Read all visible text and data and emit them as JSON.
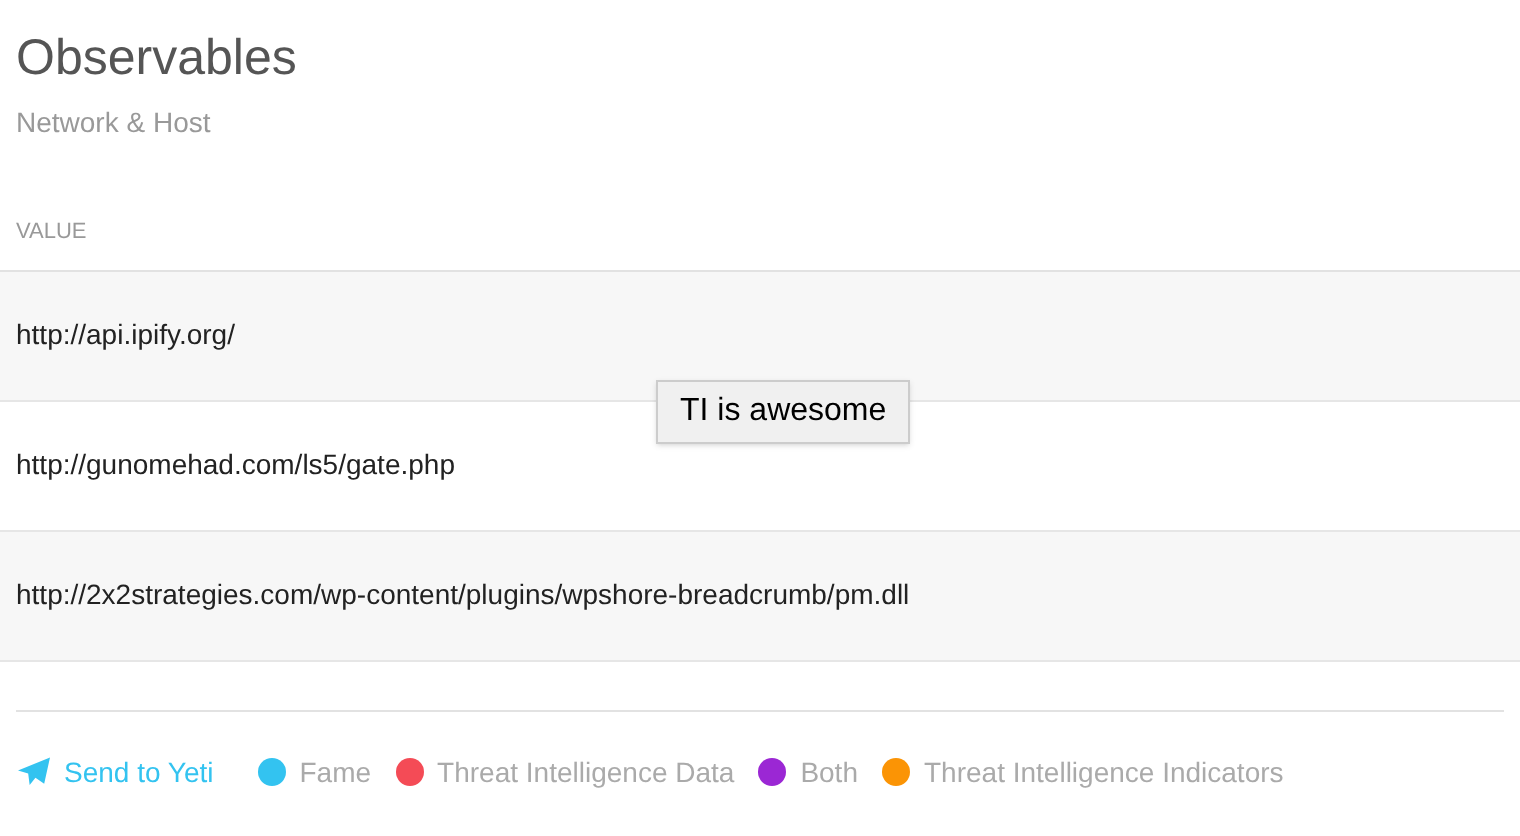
{
  "header": {
    "title": "Observables",
    "subtitle": "Network & Host"
  },
  "table": {
    "columns": [
      "VALUE"
    ],
    "rows": [
      [
        "http://api.ipify.org/"
      ],
      [
        "http://gunomehad.com/ls5/gate.php"
      ],
      [
        "http://2x2strategies.com/wp-content/plugins/wpshore-breadcrumb/pm.dll"
      ]
    ]
  },
  "tooltip": "TI is awesome",
  "footer": {
    "send_button": "Send to Yeti",
    "legend": [
      {
        "label": "Fame",
        "color": "#33c3f0"
      },
      {
        "label": "Threat Intelligence Data",
        "color": "#f44b56"
      },
      {
        "label": "Both",
        "color": "#9b27d4"
      },
      {
        "label": "Threat Intelligence Indicators",
        "color": "#fb9405"
      }
    ]
  }
}
